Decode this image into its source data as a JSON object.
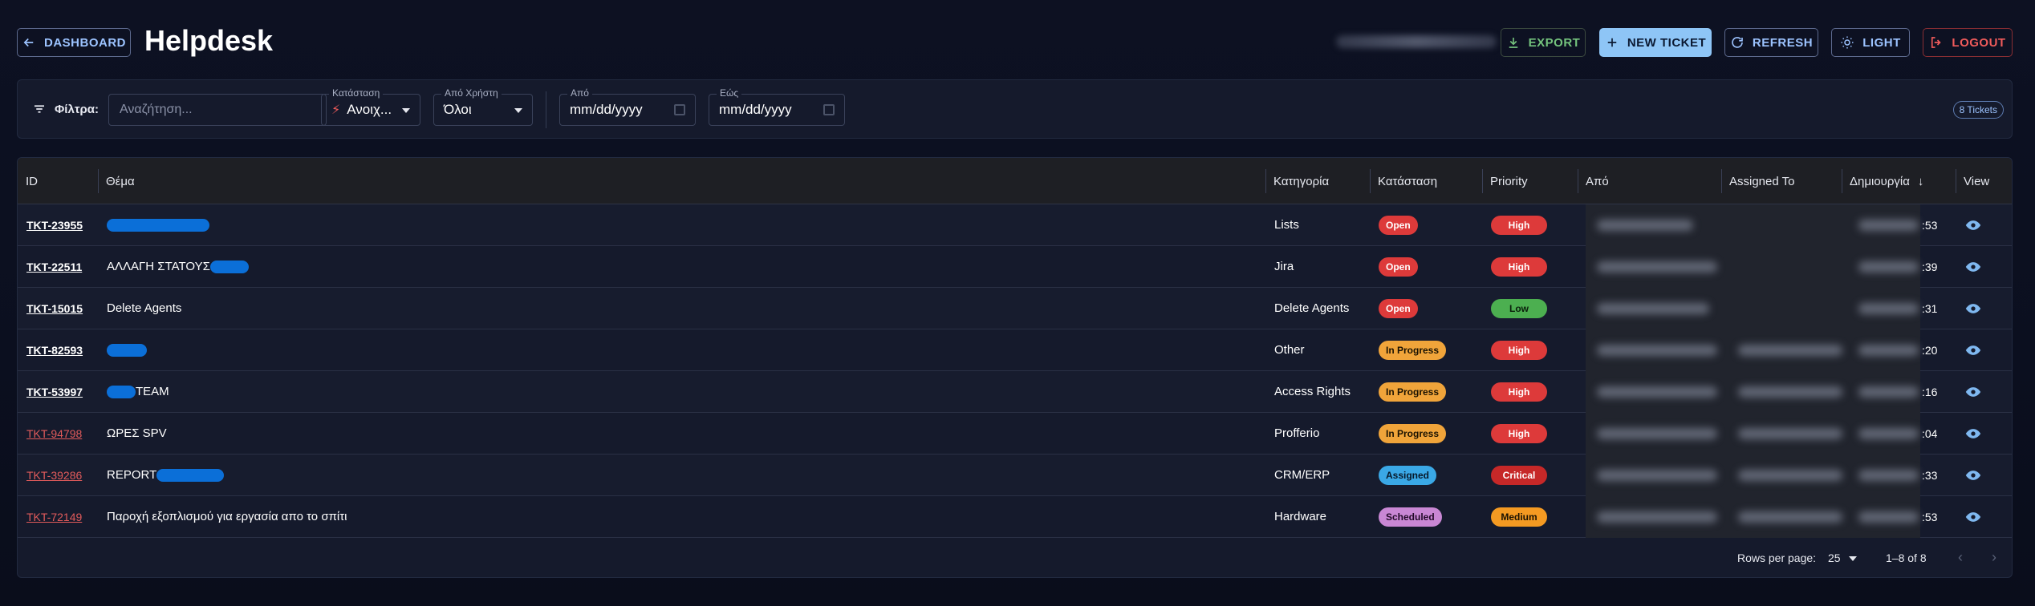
{
  "header": {
    "dashboard_label": "DASHBOARD",
    "title": "Helpdesk",
    "export_label": "EXPORT",
    "new_ticket_label": "NEW TICKET",
    "refresh_label": "REFRESH",
    "light_label": "LIGHT",
    "logout_label": "LOGOUT"
  },
  "filters": {
    "label": "Φίλτρα:",
    "search_placeholder": "Αναζήτηση...",
    "status": {
      "label": "Κατάσταση",
      "value": "Ανοιχ..."
    },
    "user": {
      "label": "Από Χρήστη",
      "value": "Όλοι"
    },
    "date_from": {
      "label": "Από",
      "value": "mm/dd/yyyy"
    },
    "date_to": {
      "label": "Εώς",
      "value": "mm/dd/yyyy"
    },
    "count": "8 Tickets"
  },
  "table": {
    "columns": {
      "id": "ID",
      "subject": "Θέμα",
      "category": "Κατηγορία",
      "status": "Κατάσταση",
      "priority": "Priority",
      "from": "Από",
      "assigned": "Assigned To",
      "created": "Δημιουργία",
      "view": "View"
    },
    "rows": [
      {
        "id": "TKT-23955",
        "subject": "",
        "category": "Lists",
        "status": "Open",
        "priority": "High",
        "time": ":53"
      },
      {
        "id": "TKT-22511",
        "subject": "ΑΛΛΑΓΗ ΣΤΑΤΟΥΣ",
        "category": "Jira",
        "status": "Open",
        "priority": "High",
        "time": ":39"
      },
      {
        "id": "TKT-15015",
        "subject": "Delete Agents",
        "category": "Delete Agents",
        "status": "Open",
        "priority": "Low",
        "time": ":31"
      },
      {
        "id": "TKT-82593",
        "subject": "",
        "category": "Other",
        "status": "In Progress",
        "priority": "High",
        "time": ":20"
      },
      {
        "id": "TKT-53997",
        "subject": "TEAM",
        "category": "Access Rights",
        "status": "In Progress",
        "priority": "High",
        "time": ":16"
      },
      {
        "id": "TKT-94798",
        "subject": "ΩΡΕΣ SPV",
        "category": "Profferio",
        "status": "In Progress",
        "priority": "High",
        "time": ":04"
      },
      {
        "id": "TKT-39286",
        "subject": "REPORT",
        "category": "CRM/ERP",
        "status": "Assigned",
        "priority": "Critical",
        "time": ":33"
      },
      {
        "id": "TKT-72149",
        "subject": "Παροχή εξοπλισμού για εργασία απο το σπίτι",
        "category": "Hardware",
        "status": "Scheduled",
        "priority": "Medium",
        "time": ":53"
      }
    ]
  },
  "pagination": {
    "rows_per_page_label": "Rows per page:",
    "rows_per_page": "25",
    "range": "1–8 of 8"
  },
  "icons": [
    "arrow-left-icon",
    "download-icon",
    "plus-icon",
    "refresh-icon",
    "sun-icon",
    "logout-icon",
    "filter-icon",
    "bolt-icon",
    "calendar-icon",
    "arrow-down-icon",
    "eye-icon",
    "chevron-left-icon",
    "chevron-right-icon"
  ],
  "colors": {
    "accent": "#9cc3ff",
    "primary_button": "#8ec5f6",
    "export": "#74c27d",
    "logout": "#ef5b5b",
    "open": "#dd3a3a",
    "in_progress": "#f0a43a",
    "assigned": "#3aa8e6",
    "scheduled": "#c987d4",
    "low": "#4caf50",
    "critical": "#c62828",
    "medium": "#f49a22"
  }
}
